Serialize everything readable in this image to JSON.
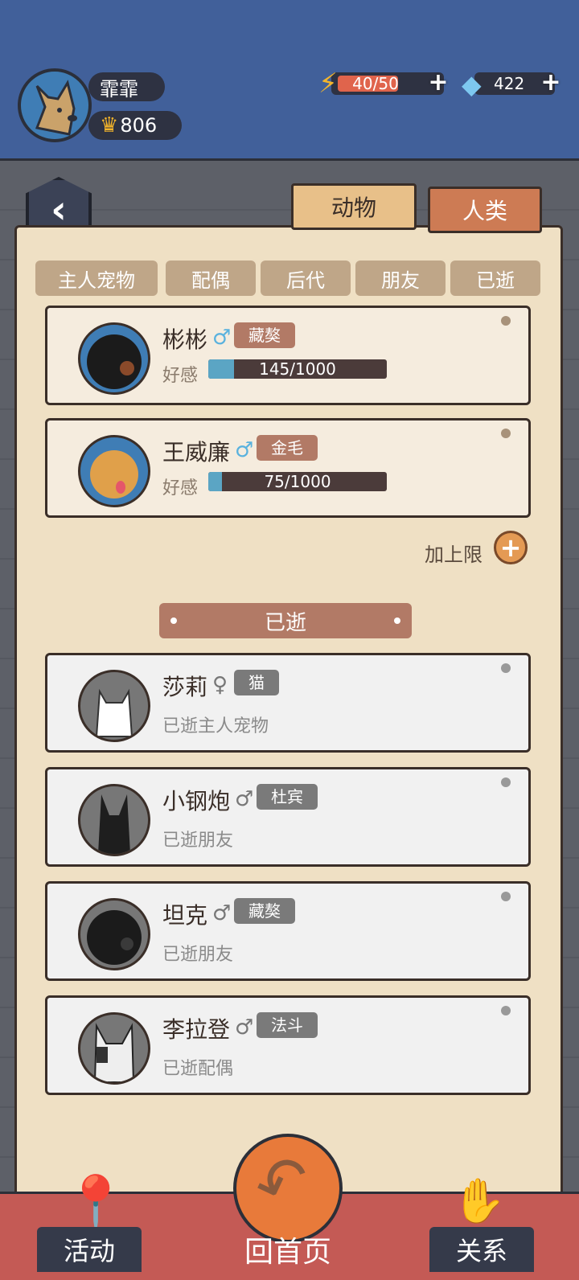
{
  "player": {
    "name": "霏霏",
    "score": "806",
    "crown_icon": "crown-icon",
    "avatar": "dog-avatar"
  },
  "resources": {
    "energy": "40/50",
    "energy_fraction": 0.8,
    "gems": "422"
  },
  "tabs": {
    "animal": "动物",
    "human": "人类",
    "active": "animal"
  },
  "filters": [
    "主人宠物",
    "配偶",
    "后代",
    "朋友",
    "已逝"
  ],
  "live_pets": [
    {
      "name": "彬彬",
      "gender": "♂",
      "breed": "藏獒",
      "affection_label": "好感",
      "affection": "145/1000",
      "affection_fraction": 0.145
    },
    {
      "name": "王威廉",
      "gender": "♂",
      "breed": "金毛",
      "affection_label": "好感",
      "affection": "75/1000",
      "affection_fraction": 0.075
    }
  ],
  "add_limit": "加上限",
  "dead_section_title": "已逝",
  "dead_pets": [
    {
      "name": "莎莉",
      "gender": "♀",
      "breed": "猫",
      "desc": "已逝主人宠物"
    },
    {
      "name": "小钢炮",
      "gender": "♂",
      "breed": "杜宾",
      "desc": "已逝朋友"
    },
    {
      "name": "坦克",
      "gender": "♂",
      "breed": "藏獒",
      "desc": "已逝朋友"
    },
    {
      "name": "李拉登",
      "gender": "♂",
      "breed": "法斗",
      "desc": "已逝配偶"
    }
  ],
  "bottom_nav": {
    "activity": "活动",
    "home": "回首页",
    "relation": "关系"
  },
  "colors": {
    "header": "#41609a",
    "paper": "#efe0c4",
    "accent": "#b27a66",
    "bottom_bar": "#c45a55"
  }
}
